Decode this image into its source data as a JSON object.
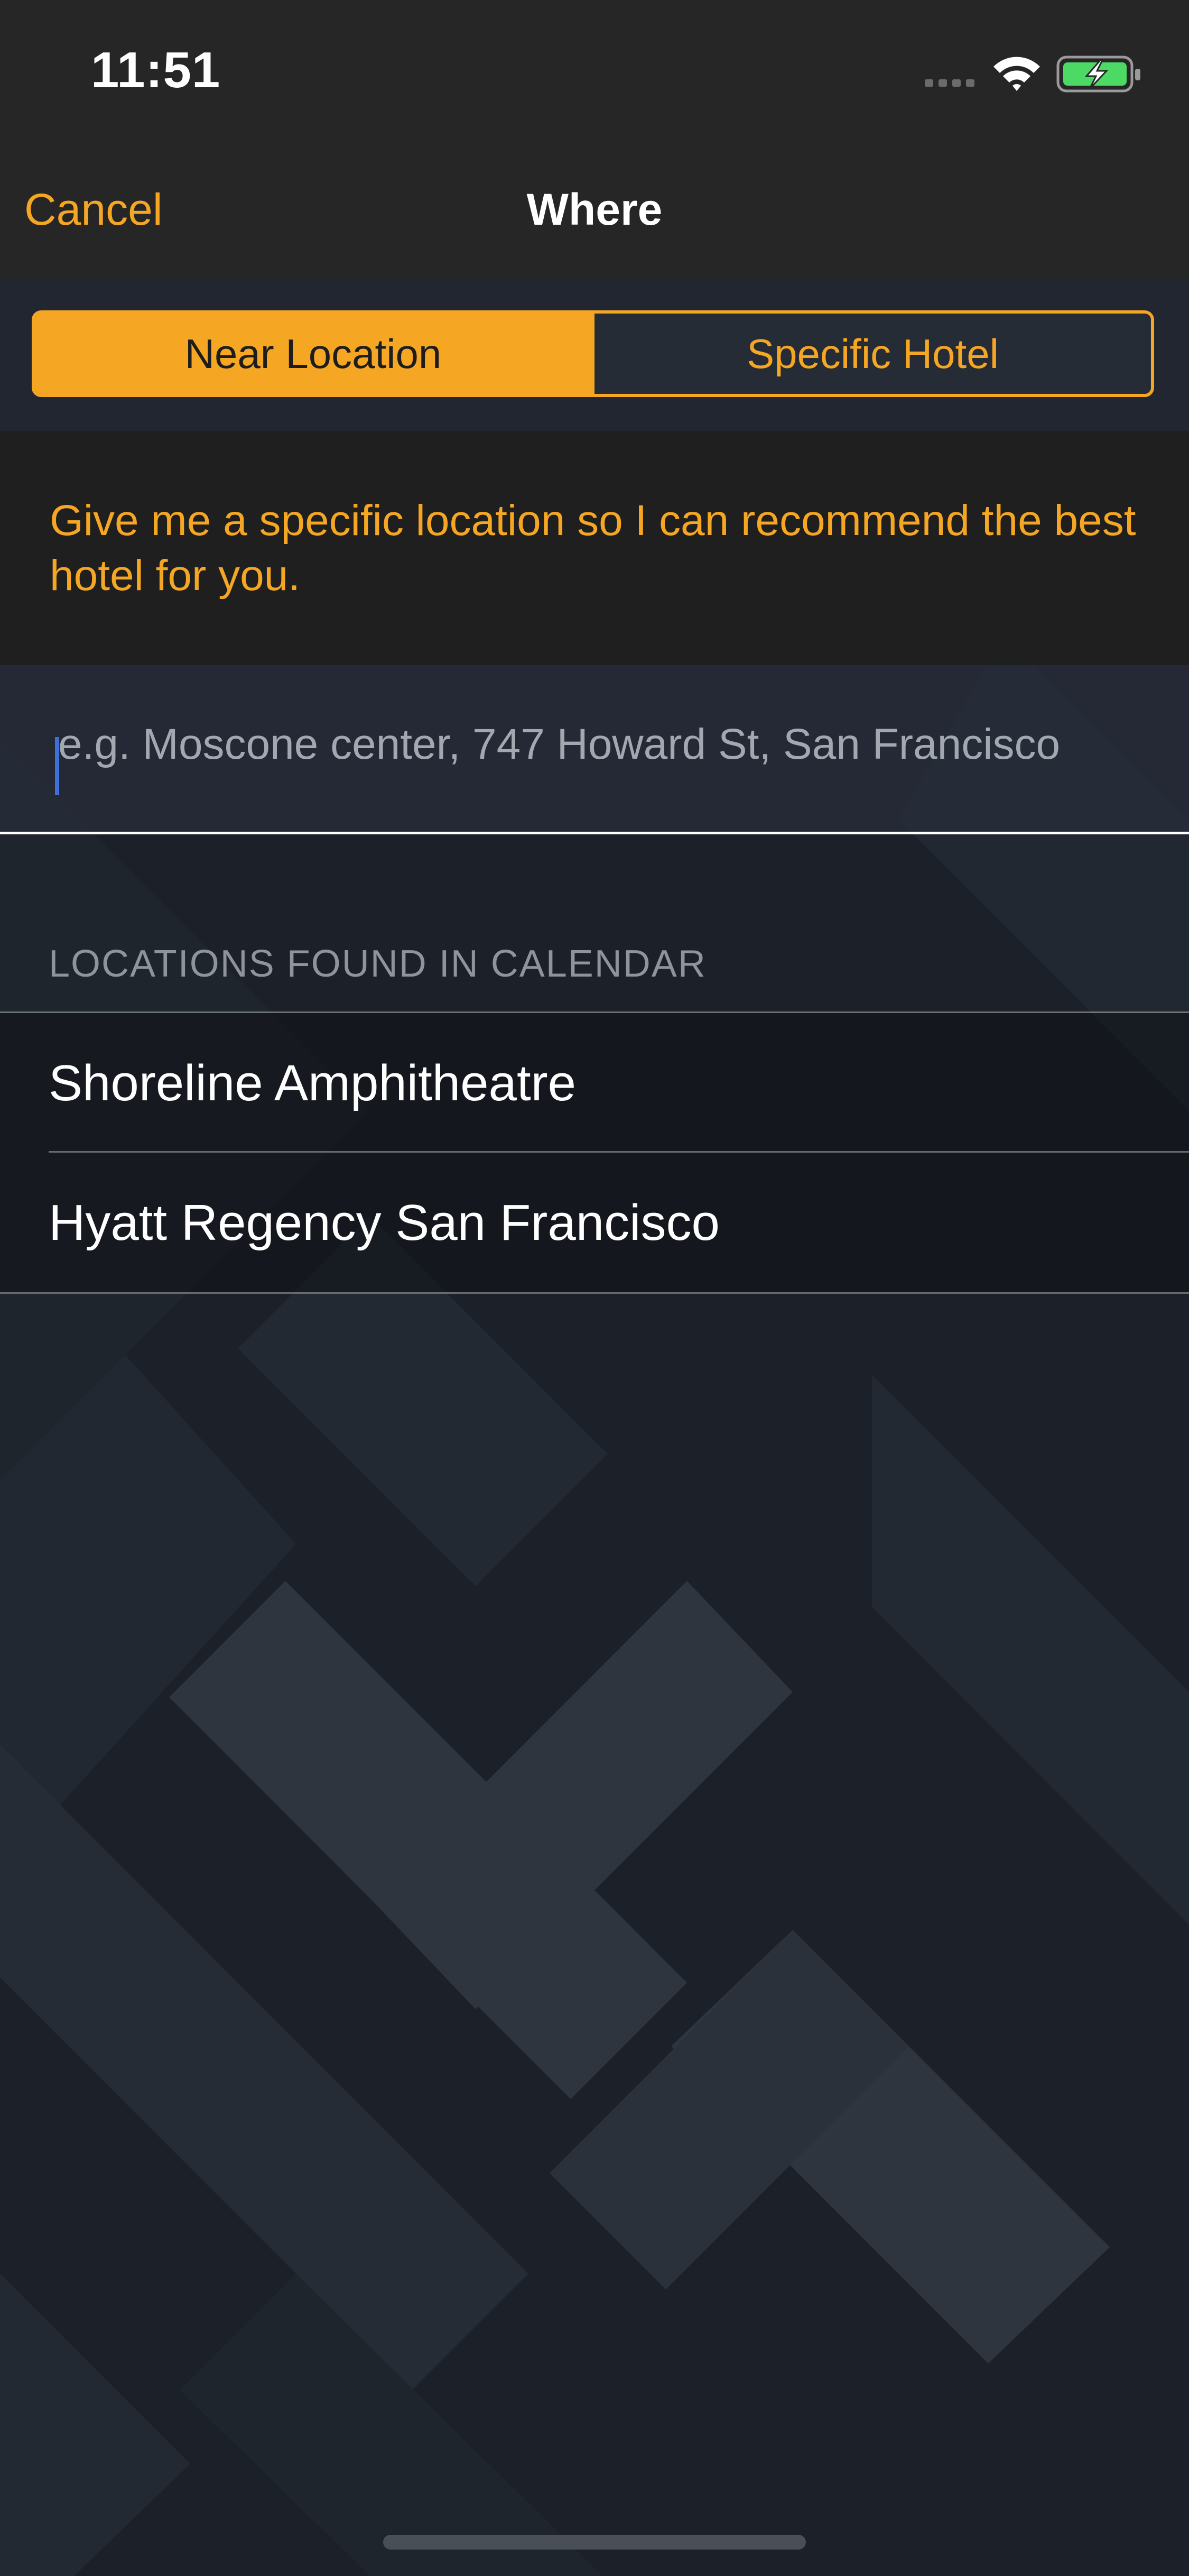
{
  "status_bar": {
    "time": "11:51"
  },
  "nav": {
    "cancel_label": "Cancel",
    "title": "Where"
  },
  "segments": {
    "active": "Near Location",
    "inactive": "Specific Hotel"
  },
  "hint": {
    "text": "Give me a specific location so I can recommend the best hotel for you."
  },
  "search": {
    "value": "",
    "placeholder": "e.g. Moscone center, 747 Howard St, San Francisco"
  },
  "calendar_locations": {
    "header": "LOCATIONS FOUND IN CALENDAR",
    "items": [
      "Shoreline Amphitheatre",
      "Hyatt Regency San Francisco"
    ]
  },
  "colors": {
    "accent": "#f5a623",
    "nav_background": "#262626",
    "background": "#1b2029"
  },
  "icons": [
    "cellular-signal-icon",
    "wifi-icon",
    "battery-charging-icon"
  ]
}
